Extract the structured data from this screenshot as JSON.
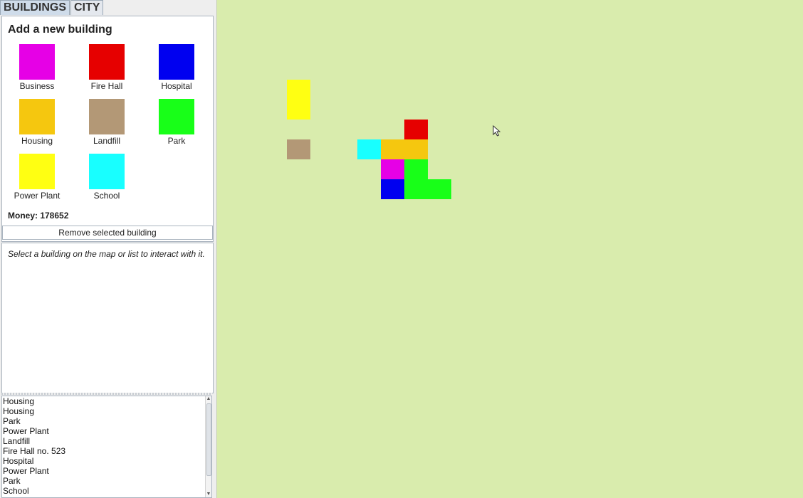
{
  "tabs": [
    {
      "label": "BUILDINGS",
      "active": true
    },
    {
      "label": "CITY",
      "active": false
    }
  ],
  "add_panel": {
    "title": "Add a new building",
    "buildings": [
      {
        "label": "Business",
        "color": "#e600e6"
      },
      {
        "label": "Fire Hall",
        "color": "#e60000"
      },
      {
        "label": "Hospital",
        "color": "#0000f0"
      },
      {
        "label": "Housing",
        "color": "#f5c70f"
      },
      {
        "label": "Landfill",
        "color": "#b39876"
      },
      {
        "label": "Park",
        "color": "#18ff18"
      },
      {
        "label": "Power Plant",
        "color": "#ffff12"
      },
      {
        "label": "School",
        "color": "#18ffff"
      }
    ],
    "money_text": "Money: 178652",
    "remove_label": "Remove selected building"
  },
  "info": {
    "text": "Select a building on the map or list to interact with it."
  },
  "list": {
    "items": [
      "Housing",
      "Housing",
      "Park",
      "Power Plant",
      "Landfill",
      "Fire Hall no. 523",
      "Hospital",
      "Power Plant",
      "Park",
      "School"
    ]
  },
  "map": {
    "background": "#d9ecad",
    "placed_buildings": [
      {
        "type": "Power Plant",
        "color": "#ffff12"
      },
      {
        "type": "Landfill",
        "color": "#b39876"
      },
      {
        "type": "Fire Hall",
        "color": "#e60000"
      },
      {
        "type": "School",
        "color": "#18ffff"
      },
      {
        "type": "Housing",
        "color": "#f5c70f"
      },
      {
        "type": "Housing",
        "color": "#f5c70f"
      },
      {
        "type": "Business",
        "color": "#e600e6"
      },
      {
        "type": "Park",
        "color": "#18ff18"
      },
      {
        "type": "Hospital",
        "color": "#0000f0"
      },
      {
        "type": "Park",
        "color": "#18ff18"
      }
    ]
  }
}
